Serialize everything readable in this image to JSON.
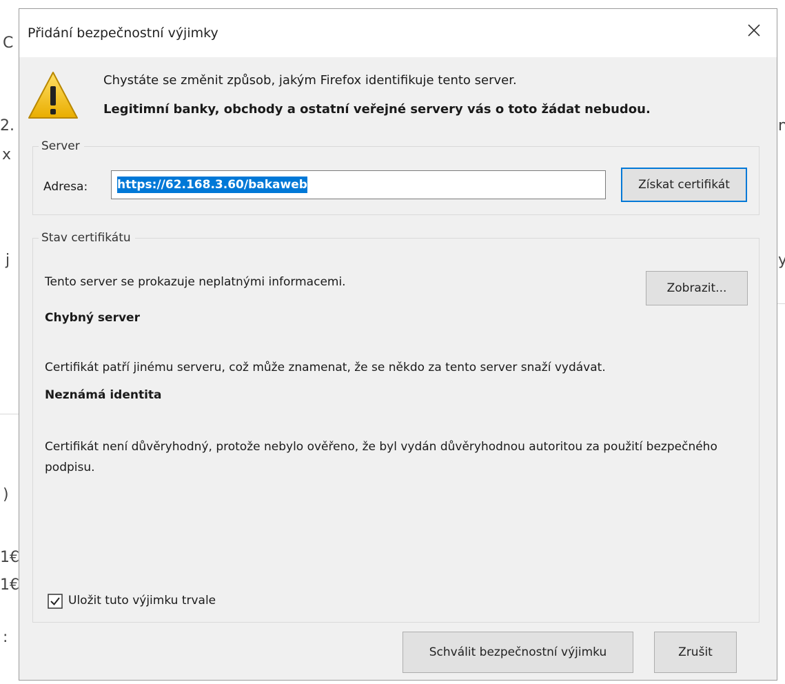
{
  "background_fragments": [
    "C",
    "2.",
    "x",
    "j",
    "n",
    "y",
    ")",
    "1€",
    "1€",
    ":"
  ],
  "dialog": {
    "title": "Přidání bezpečnostní výjimky",
    "intro_line1": "Chystáte se změnit způsob, jakým Firefox identifikuje tento server.",
    "intro_line2": "Legitimní banky, obchody a ostatní veřejné servery vás o toto žádat nebudou.",
    "server": {
      "legend": "Server",
      "address_label": "Adresa:",
      "address_value": "https://62.168.3.60/bakaweb",
      "get_cert_button": "Získat certifikát"
    },
    "cert_status": {
      "legend": "Stav certifikátu",
      "status_text": "Tento server se prokazuje neplatnými informacemi.",
      "view_button": "Zobrazit...",
      "issue1_title": "Chybný server",
      "issue1_text": "Certifikát patří jinému serveru, což může znamenat, že se někdo za tento server snaží vydávat.",
      "issue2_title": "Neznámá identita",
      "issue2_text": "Certifikát není důvěryhodný, protože nebylo ověřeno, že byl vydán důvěryhodnou autoritou za použití bezpečného podpisu.",
      "permanent_checkbox_label": "Uložit tuto výjimku trvale",
      "permanent_checked": true
    },
    "approve_button": "Schválit bezpečnostní výjimku",
    "cancel_button": "Zrušit"
  },
  "colors": {
    "dialog_bg": "#f0f0f0",
    "selection": "#0078d7",
    "warning": "#f2c200"
  },
  "icons": {
    "close": "close-icon",
    "warning": "warning-icon",
    "checkbox": "checkbox-icon"
  }
}
